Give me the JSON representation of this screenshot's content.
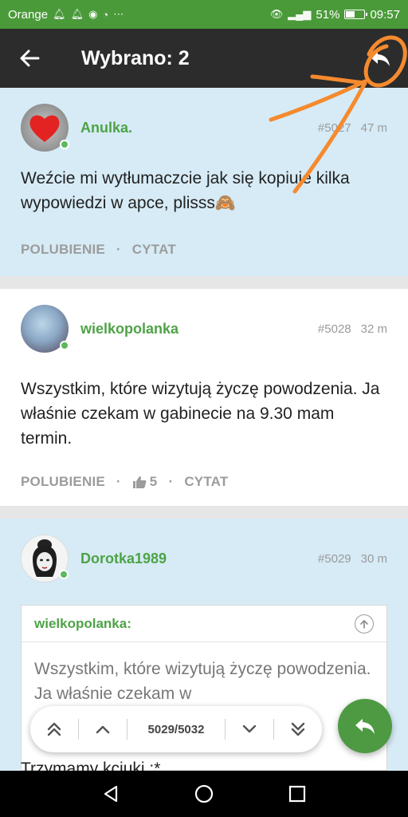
{
  "status_bar": {
    "carrier": "Orange",
    "battery": "51%",
    "battery_level": 0.51,
    "time": "09:57"
  },
  "app_bar": {
    "title": "Wybrano: 2"
  },
  "posts": [
    {
      "author": "Anulka.",
      "number": "#5027",
      "age": "47 m",
      "body": "Weźcie mi wytłumaczcie jak się kopiuje kilka wypowiedzi w apce, plisss🙈",
      "actions": {
        "like": "POLUBIENIE",
        "quote": "CYTAT"
      }
    },
    {
      "author": "wielkopolanka",
      "number": "#5028",
      "age": "32 m",
      "body": "Wszystkim, które wizytują życzę powodzenia. Ja właśnie czekam w gabinecie na 9.30 mam termin.",
      "actions": {
        "like": "POLUBIENIE",
        "likes_count": "5",
        "quote": "CYTAT"
      }
    },
    {
      "author": "Dorotka1989",
      "number": "#5029",
      "age": "30 m",
      "quote": {
        "author": "wielkopolanka:",
        "text": "Wszystkim, które wizytują życzę powodzenia. Ja właśnie czekam w"
      },
      "body_partial": "Trzymamy kciuki :*"
    }
  ],
  "pager": {
    "counter": "5029/5032"
  },
  "icons": {
    "back": "arrow-left-icon",
    "reply": "reply-icon",
    "thumb": "thumbs-up-icon",
    "first": "double-chevron-up-icon",
    "prev": "chevron-up-icon",
    "next": "chevron-down-icon",
    "last": "double-chevron-down-icon"
  },
  "colors": {
    "status_bar": "#4a9a3a",
    "app_bar": "#2c2c2c",
    "selected_post": "#d6ebf6",
    "author_green": "#4ea346",
    "fab": "#4e9a43",
    "annotation": "#f58a2e"
  }
}
